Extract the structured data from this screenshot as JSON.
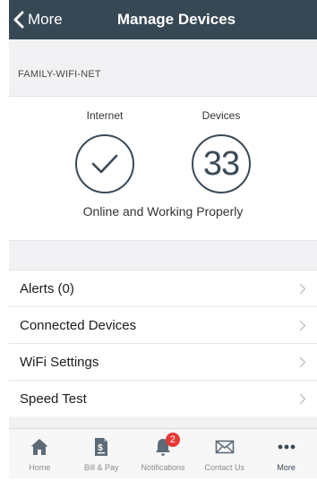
{
  "nav": {
    "back_label": "More",
    "title": "Manage Devices"
  },
  "network": {
    "name": "FAMILY-WIFI-NET"
  },
  "status": {
    "internet_label": "Internet",
    "devices_label": "Devices",
    "device_count": "33",
    "message": "Online and Working Properly"
  },
  "menu": {
    "items": [
      {
        "label": "Alerts (0)"
      },
      {
        "label": "Connected Devices"
      },
      {
        "label": "WiFi Settings"
      },
      {
        "label": "Speed Test"
      }
    ]
  },
  "tabs": {
    "items": [
      {
        "label": "Home",
        "icon": "home-icon"
      },
      {
        "label": "Bill & Pay",
        "icon": "bill-icon"
      },
      {
        "label": "Notifications",
        "icon": "bell-icon",
        "badge": "2"
      },
      {
        "label": "Contact Us",
        "icon": "envelope-icon"
      },
      {
        "label": "More",
        "icon": "more-icon"
      }
    ]
  },
  "colors": {
    "navbar": "#374855",
    "accent": "#3b4a57",
    "badge": "#e53935",
    "background": "#f2f2f4"
  }
}
